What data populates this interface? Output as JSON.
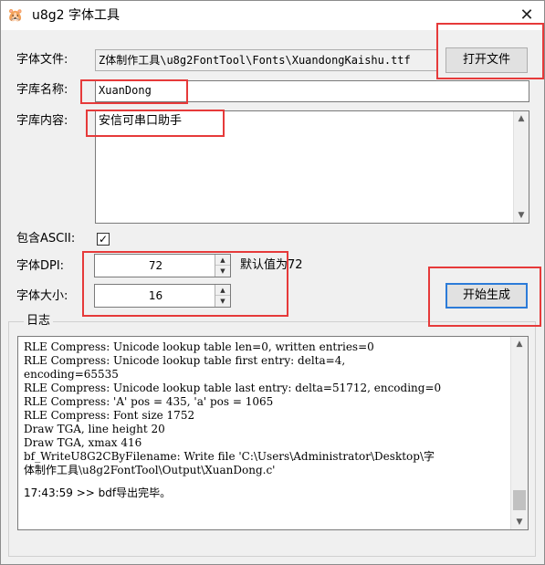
{
  "window": {
    "title": "u8g2 字体工具",
    "icon": "hamster-app-icon",
    "close_glyph": "✕"
  },
  "font_file": {
    "label": "字体文件:",
    "value": "Z体制作工具\\u8g2FontTool\\Fonts\\XuandongKaishu.ttf",
    "open_button": "打开文件"
  },
  "library_name": {
    "label": "字库名称:",
    "value": "XuanDong"
  },
  "library_content": {
    "label": "字库内容:",
    "value": "安信可串口助手"
  },
  "include_ascii": {
    "label": "包含ASCII:",
    "checked": true,
    "check_glyph": "✓"
  },
  "dpi": {
    "label": "字体DPI:",
    "value": "72",
    "hint": "默认值为72"
  },
  "size": {
    "label": "字体大小:",
    "value": "16"
  },
  "generate_button": "开始生成",
  "log": {
    "title": "日志",
    "lines": [
      "RLE Compress: Unicode lookup table len=0, written entries=0",
      "RLE Compress: Unicode lookup table first entry: delta=4,",
      "encoding=65535",
      "RLE Compress: Unicode lookup table last entry: delta=51712, encoding=0",
      "RLE Compress: 'A' pos = 435, 'a' pos = 1065",
      "RLE Compress: Font size 1752",
      "Draw TGA, line height 20",
      "Draw TGA, xmax 416",
      "bf_WriteU8G2CByFilename: Write file 'C:\\Users\\Administrator\\Desktop\\字",
      "体制作工具\\u8g2FontTool\\Output\\XuanDong.c'"
    ],
    "final": "17:43:59 >> bdf导出完毕。"
  },
  "colors": {
    "highlight_red": "#e63a3a",
    "default_button_border": "#2c7bd8"
  }
}
